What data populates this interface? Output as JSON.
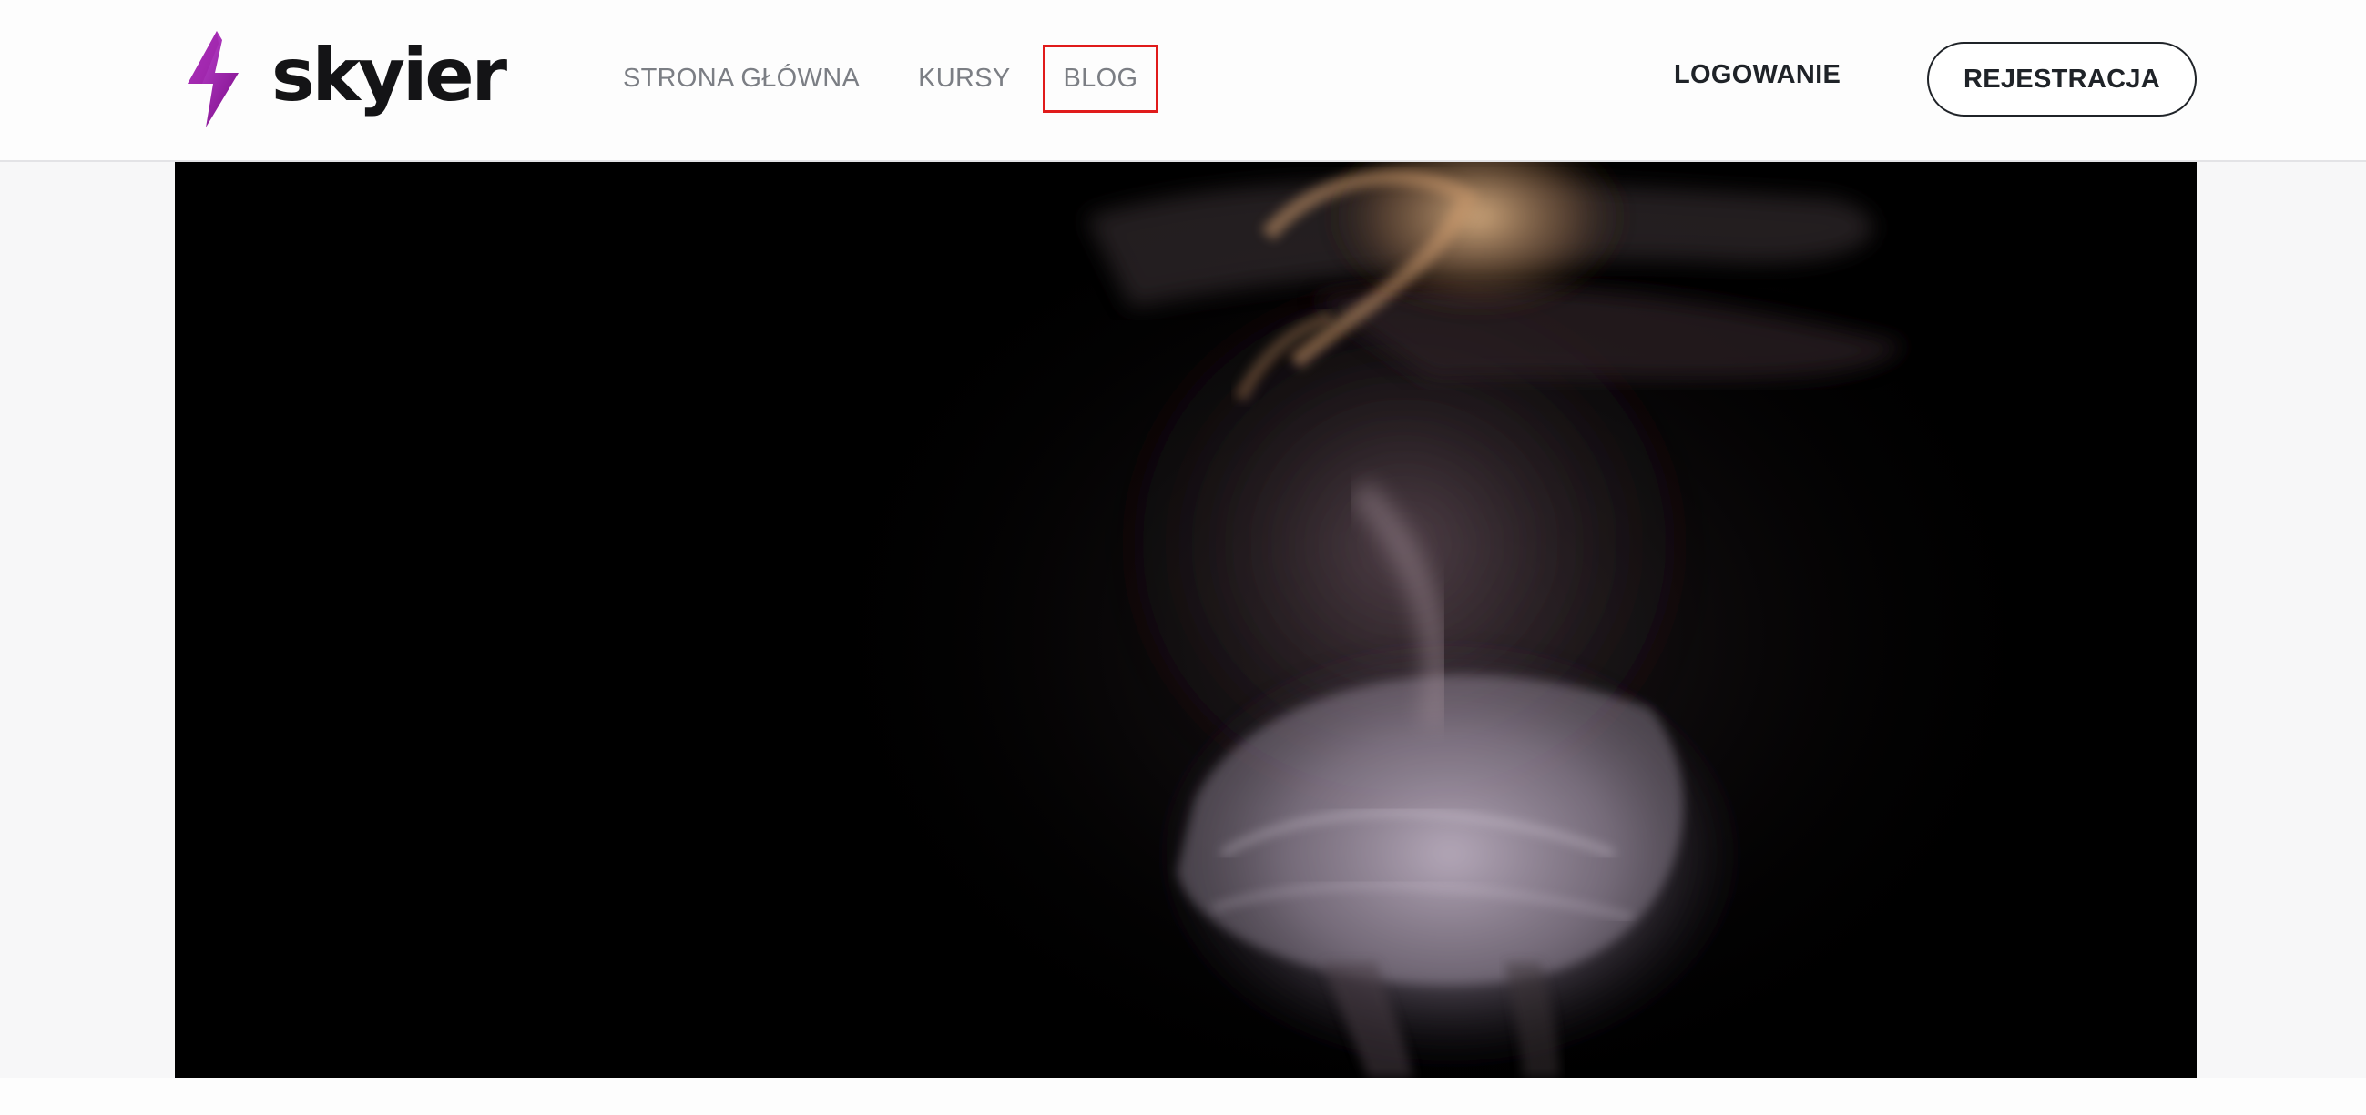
{
  "brand": {
    "name": "skyier",
    "icon": "lightning-bolt-icon",
    "accent_colors": [
      "#8a0f8e",
      "#c44bd6"
    ]
  },
  "nav": {
    "items": [
      {
        "label": "STRONA GŁÓWNA",
        "highlighted": false
      },
      {
        "label": "KURSY",
        "highlighted": false
      },
      {
        "label": "BLOG",
        "highlighted": true
      }
    ],
    "highlight_color": "#e01b1b"
  },
  "auth": {
    "login_label": "LOGOWANIE",
    "register_label": "REJESTRACJA"
  },
  "hero": {
    "image": "dancer-motion-blur-photo",
    "background": "#000000"
  }
}
